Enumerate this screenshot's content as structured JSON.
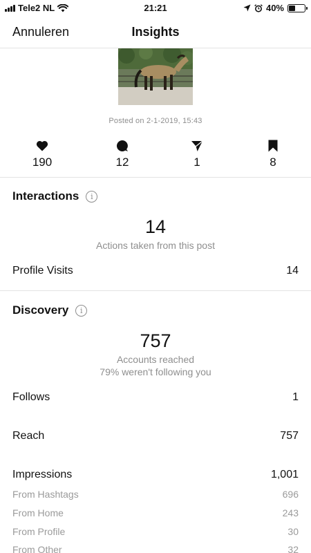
{
  "status_bar": {
    "carrier": "Tele2 NL",
    "time": "21:21",
    "battery": "40%",
    "battery_level": 0.4
  },
  "nav": {
    "cancel_label": "Annuleren",
    "title": "Insights"
  },
  "post": {
    "posted_on": "Posted on 2-1-2019, 15:43"
  },
  "stats": [
    {
      "icon": "heart-icon",
      "value": "190"
    },
    {
      "icon": "comment-icon",
      "value": "12"
    },
    {
      "icon": "share-icon",
      "value": "1"
    },
    {
      "icon": "bookmark-icon",
      "value": "8"
    }
  ],
  "interactions": {
    "title": "Interactions",
    "total": "14",
    "total_label": "Actions taken from this post",
    "profile_visits_label": "Profile Visits",
    "profile_visits_value": "14"
  },
  "discovery": {
    "title": "Discovery",
    "total": "757",
    "total_label": "Accounts reached",
    "not_following_label": "79% weren't following you",
    "follows_label": "Follows",
    "follows_value": "1",
    "reach_label": "Reach",
    "reach_value": "757",
    "impressions_label": "Impressions",
    "impressions_value": "1,001",
    "sources": [
      {
        "label": "From Hashtags",
        "value": "696"
      },
      {
        "label": "From Home",
        "value": "243"
      },
      {
        "label": "From Profile",
        "value": "30"
      },
      {
        "label": "From Other",
        "value": "32"
      }
    ]
  }
}
